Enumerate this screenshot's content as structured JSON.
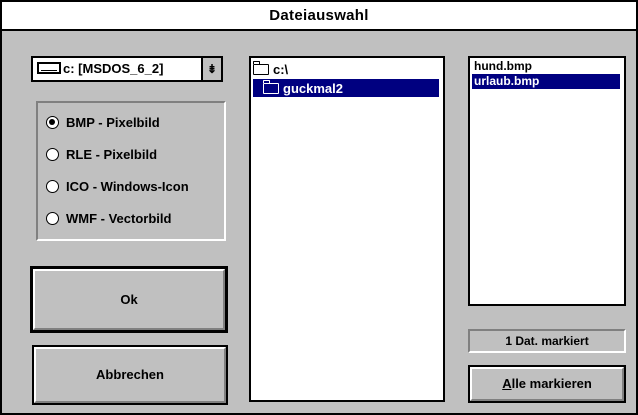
{
  "window": {
    "title": "Dateiauswahl"
  },
  "drive": {
    "selected": "c: [MSDOS_6_2]",
    "dropdown_glyph": "⇟"
  },
  "file_types": [
    {
      "label": "BMP - Pixelbild",
      "selected": true
    },
    {
      "label": "RLE - Pixelbild",
      "selected": false
    },
    {
      "label": "ICO - Windows-Icon",
      "selected": false
    },
    {
      "label": "WMF - Vectorbild",
      "selected": false
    }
  ],
  "buttons": {
    "ok": "Ok",
    "cancel": "Abbrechen",
    "select_all_first": "A",
    "select_all_rest": "lle markieren"
  },
  "directories": {
    "items": [
      {
        "label": "c:\\",
        "icon": "folder-open-icon",
        "selected": false
      },
      {
        "label": "guckmal2",
        "icon": "folder-open-icon",
        "selected": true
      }
    ]
  },
  "files": {
    "items": [
      {
        "label": "hund.bmp",
        "selected": false
      },
      {
        "label": "urlaub.bmp",
        "selected": true
      }
    ]
  },
  "status": "1 Dat. markiert",
  "colors": {
    "dialog_bg": "#c0c0c0",
    "selection": "#000080",
    "list_bg": "#ffffff"
  }
}
